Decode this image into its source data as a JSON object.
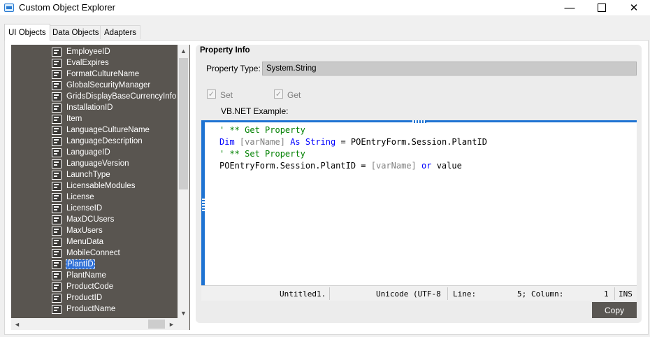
{
  "window": {
    "title": "Custom Object Explorer"
  },
  "window_controls": {
    "minimize": "—",
    "close": "✕"
  },
  "tabs": [
    {
      "label": "UI Objects"
    },
    {
      "label": "Data Objects"
    },
    {
      "label": "Adapters"
    }
  ],
  "tree": {
    "items": [
      "EmployeeID",
      "EvalExpires",
      "FormatCultureName",
      "GlobalSecurityManager",
      "GridsDisplayBaseCurrencyInfo",
      "InstallationID",
      "Item",
      "LanguageCultureName",
      "LanguageDescription",
      "LanguageID",
      "LanguageVersion",
      "LaunchType",
      "LicensableModules",
      "License",
      "LicenseID",
      "MaxDCUsers",
      "MaxUsers",
      "MenuData",
      "MobileConnect",
      "PlantID",
      "PlantName",
      "ProductCode",
      "ProductID",
      "ProductName"
    ],
    "selected": "PlantID"
  },
  "scroll": {
    "up": "▲",
    "down": "▼",
    "left": "◄",
    "right": "►"
  },
  "property_info": {
    "title": "Property Info",
    "type_label": "Property Type:",
    "type_value": "System.String",
    "set_label": "Set",
    "get_label": "Get",
    "check_mark": "✓",
    "example_label": "VB.NET Example:"
  },
  "code": {
    "line1_comment": "' ** Get Property",
    "line2_dim": "Dim",
    "line2_var": "[varName]",
    "line2_as": "As",
    "line2_string": "String",
    "line2_rest": "= POEntryForm.Session.PlantID",
    "line3_comment": "' ** Set Property",
    "line4_lhs": "POEntryForm.Session.PlantID =",
    "line4_var": "[varName]",
    "line4_or": "or",
    "line4_value": "value"
  },
  "status_bar": {
    "file": "Untitled1.",
    "encoding": "Unicode (UTF-8",
    "line_label": "Line:",
    "line_value": "5;",
    "column_label": "Column:",
    "column_value": "1",
    "mode": "INS"
  },
  "copy_button": {
    "label": "Copy"
  },
  "colors": {
    "tree_bg": "#595550",
    "accent": "#1e73d2",
    "comment": "#008000",
    "keyword": "#0000ff"
  }
}
